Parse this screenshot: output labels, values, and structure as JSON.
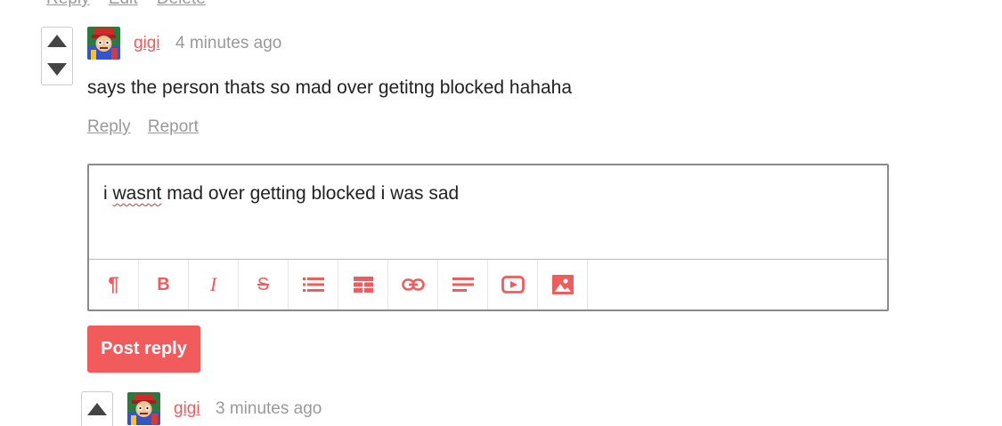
{
  "previous_actions": [
    "Reply",
    "Edit",
    "Delete"
  ],
  "comment": {
    "author": "gigi",
    "time": "4 minutes ago",
    "text": "says the person thats so mad over getitng blocked hahaha",
    "actions": {
      "reply": "Reply",
      "report": "Report"
    }
  },
  "reply_editor": {
    "text_prefix": "i ",
    "text_misspelled": "wasnt",
    "text_suffix": " mad over getting blocked i was sad",
    "toolbar": [
      {
        "name": "paragraph-icon",
        "glyph": "¶"
      },
      {
        "name": "bold-icon",
        "glyph": "B"
      },
      {
        "name": "italic-icon",
        "glyph": "I"
      },
      {
        "name": "strikethrough-icon",
        "glyph": "S"
      },
      {
        "name": "list-icon",
        "glyph": ""
      },
      {
        "name": "table-icon",
        "glyph": ""
      },
      {
        "name": "link-icon",
        "glyph": ""
      },
      {
        "name": "align-icon",
        "glyph": ""
      },
      {
        "name": "video-icon",
        "glyph": ""
      },
      {
        "name": "image-icon",
        "glyph": ""
      }
    ]
  },
  "post_button": "Post reply",
  "next_comment": {
    "author": "gigi",
    "time": "3 minutes ago"
  },
  "colors": {
    "accent": "#f25b5b",
    "muted": "#999999"
  }
}
